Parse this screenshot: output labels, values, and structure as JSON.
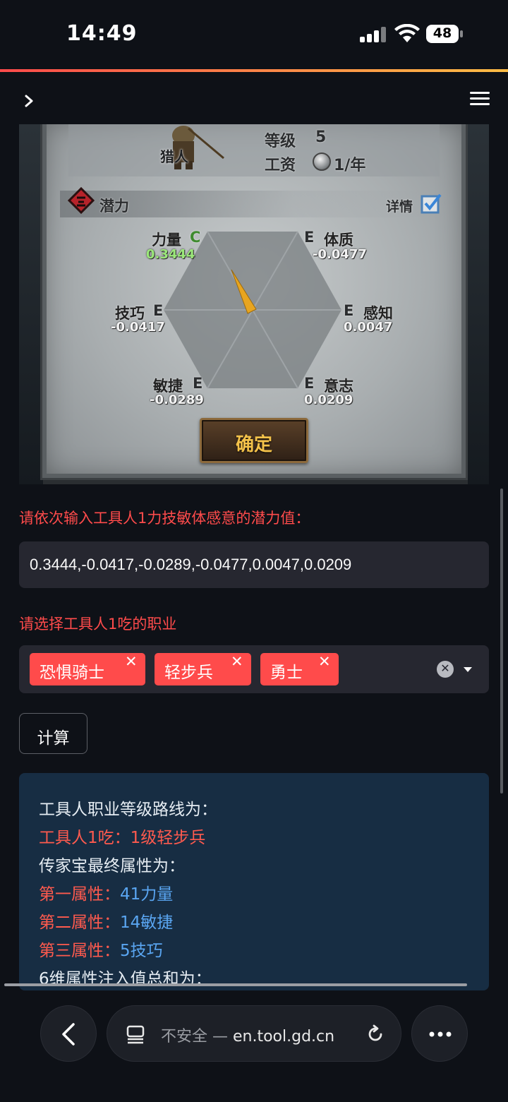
{
  "status_bar": {
    "time": "14:49",
    "battery": "48"
  },
  "game": {
    "class_name": "猎人",
    "level_label": "等级",
    "level_value": "5",
    "wage_label": "工资",
    "wage_value": "1/年",
    "potential_label": "潜力",
    "detail_label": "详情",
    "stats": {
      "strength": {
        "name": "力量",
        "grade": "C",
        "value": "0.3444"
      },
      "constitution": {
        "name": "体质",
        "grade": "E",
        "value": "-0.0477"
      },
      "skill": {
        "name": "技巧",
        "grade": "E",
        "value": "-0.0417"
      },
      "perception": {
        "name": "感知",
        "grade": "E",
        "value": "0.0047"
      },
      "agility": {
        "name": "敏捷",
        "grade": "E",
        "value": "-0.0289"
      },
      "will": {
        "name": "意志",
        "grade": "E",
        "value": "0.0209"
      }
    },
    "confirm_label": "确定"
  },
  "form": {
    "potential_prompt": "请依次输入工具人1力技敏体感意的潜力值：",
    "potential_value": "0.3444,-0.0417,-0.0289,-0.0477,0.0047,0.0209",
    "class_prompt": "请选择工具人1吃的职业",
    "selected_classes": [
      "恐惧骑士",
      "轻步兵",
      "勇士"
    ],
    "calculate_label": "计算"
  },
  "result": {
    "route_title": "工具人职业等级路线为：",
    "route_key": "工具人1吃：",
    "route_value": "1级轻步兵",
    "heirloom_title": "传家宝最终属性为：",
    "attr1_key": "第一属性：",
    "attr1_value": "41力量",
    "attr2_key": "第二属性：",
    "attr2_value": "14敏捷",
    "attr3_key": "第三属性：",
    "attr3_value": "5技巧",
    "sum_title": "6维属性注入值总和为："
  },
  "browser": {
    "insecure": "不安全 —",
    "domain": "en.tool.gd.cn"
  },
  "colors": {
    "accent": "#ff4b4b",
    "result_bg": "#172d43",
    "result_value": "#5aa6f2",
    "input_bg": "#262730"
  }
}
